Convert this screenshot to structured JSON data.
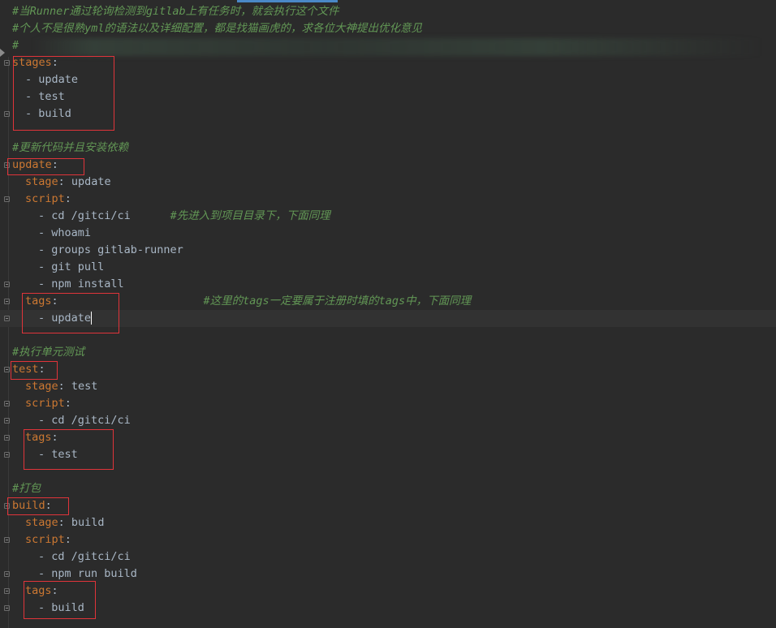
{
  "editor": {
    "lines": [
      {
        "indent": 0,
        "segments": [
          {
            "cls": "c",
            "text": "#当Runner通过轮询检测到gitlab上有任务时，就会执行这个文件"
          }
        ]
      },
      {
        "indent": 0,
        "segments": [
          {
            "cls": "c",
            "text": "#个人不是很熟yml的语法以及详细配置，都是找猫画虎的，求各位大神提出优化意见"
          }
        ]
      },
      {
        "indent": 0,
        "segments": [
          {
            "cls": "c",
            "text": "#"
          }
        ]
      },
      {
        "indent": 0,
        "fold": true,
        "segments": [
          {
            "cls": "k",
            "text": "stages"
          },
          {
            "cls": "v",
            "text": ":"
          }
        ]
      },
      {
        "indent": 1,
        "segments": [
          {
            "cls": "v",
            "text": "- update"
          }
        ]
      },
      {
        "indent": 1,
        "segments": [
          {
            "cls": "v",
            "text": "- test"
          }
        ]
      },
      {
        "indent": 1,
        "fold": true,
        "segments": [
          {
            "cls": "v",
            "text": "- build"
          }
        ]
      },
      {
        "indent": 0,
        "segments": []
      },
      {
        "indent": 0,
        "segments": [
          {
            "cls": "c",
            "text": "#更新代码并且安装依赖"
          }
        ]
      },
      {
        "indent": 0,
        "fold": true,
        "segments": [
          {
            "cls": "k",
            "text": "update"
          },
          {
            "cls": "v",
            "text": ":"
          }
        ]
      },
      {
        "indent": 1,
        "segments": [
          {
            "cls": "k",
            "text": "stage"
          },
          {
            "cls": "v",
            "text": ": update"
          }
        ]
      },
      {
        "indent": 1,
        "fold": true,
        "segments": [
          {
            "cls": "k",
            "text": "script"
          },
          {
            "cls": "v",
            "text": ":"
          }
        ]
      },
      {
        "indent": 2,
        "segments": [
          {
            "cls": "v",
            "text": "- cd /gitci/ci      "
          },
          {
            "cls": "c",
            "text": "#先进入到项目目录下，下面同理"
          }
        ]
      },
      {
        "indent": 2,
        "segments": [
          {
            "cls": "v",
            "text": "- whoami"
          }
        ]
      },
      {
        "indent": 2,
        "segments": [
          {
            "cls": "v",
            "text": "- groups gitlab-runner"
          }
        ]
      },
      {
        "indent": 2,
        "segments": [
          {
            "cls": "v",
            "text": "- git pull"
          }
        ]
      },
      {
        "indent": 2,
        "fold": true,
        "segments": [
          {
            "cls": "v",
            "text": "- npm install"
          }
        ]
      },
      {
        "indent": 1,
        "fold": true,
        "segments": [
          {
            "cls": "k",
            "text": "tags"
          },
          {
            "cls": "v",
            "text": ":                      "
          },
          {
            "cls": "c",
            "text": "#这里的tags一定要属于注册时填的tags中，下面同理"
          }
        ]
      },
      {
        "indent": 2,
        "fold": true,
        "cursor": true,
        "segments": [
          {
            "cls": "v",
            "text": "- update"
          }
        ]
      },
      {
        "indent": 0,
        "segments": []
      },
      {
        "indent": 0,
        "segments": [
          {
            "cls": "c",
            "text": "#执行单元测试"
          }
        ]
      },
      {
        "indent": 0,
        "fold": true,
        "segments": [
          {
            "cls": "k",
            "text": "test"
          },
          {
            "cls": "v",
            "text": ":"
          }
        ]
      },
      {
        "indent": 1,
        "segments": [
          {
            "cls": "k",
            "text": "stage"
          },
          {
            "cls": "v",
            "text": ": test"
          }
        ]
      },
      {
        "indent": 1,
        "fold": true,
        "segments": [
          {
            "cls": "k",
            "text": "script"
          },
          {
            "cls": "v",
            "text": ":"
          }
        ]
      },
      {
        "indent": 2,
        "fold": true,
        "segments": [
          {
            "cls": "v",
            "text": "- cd /gitci/ci"
          }
        ]
      },
      {
        "indent": 1,
        "fold": true,
        "segments": [
          {
            "cls": "k",
            "text": "tags"
          },
          {
            "cls": "v",
            "text": ":"
          }
        ]
      },
      {
        "indent": 2,
        "fold": true,
        "segments": [
          {
            "cls": "v",
            "text": "- test"
          }
        ]
      },
      {
        "indent": 0,
        "segments": []
      },
      {
        "indent": 0,
        "segments": [
          {
            "cls": "c",
            "text": "#打包"
          }
        ]
      },
      {
        "indent": 0,
        "fold": true,
        "segments": [
          {
            "cls": "k",
            "text": "build"
          },
          {
            "cls": "v",
            "text": ":"
          }
        ]
      },
      {
        "indent": 1,
        "segments": [
          {
            "cls": "k",
            "text": "stage"
          },
          {
            "cls": "v",
            "text": ": build"
          }
        ]
      },
      {
        "indent": 1,
        "fold": true,
        "segments": [
          {
            "cls": "k",
            "text": "script"
          },
          {
            "cls": "v",
            "text": ":"
          }
        ]
      },
      {
        "indent": 2,
        "segments": [
          {
            "cls": "v",
            "text": "- cd /gitci/ci"
          }
        ]
      },
      {
        "indent": 2,
        "fold": true,
        "segments": [
          {
            "cls": "v",
            "text": "- npm run build"
          }
        ]
      },
      {
        "indent": 1,
        "fold": true,
        "segments": [
          {
            "cls": "k",
            "text": "tags"
          },
          {
            "cls": "v",
            "text": ":"
          }
        ]
      },
      {
        "indent": 2,
        "fold": true,
        "segments": [
          {
            "cls": "v",
            "text": "- build"
          }
        ]
      }
    ]
  },
  "colors": {
    "background": "#2b2b2b",
    "key": "#cc7832",
    "value": "#a9b7c6",
    "comment": "#629755",
    "highlight_box": "#e0343a"
  }
}
